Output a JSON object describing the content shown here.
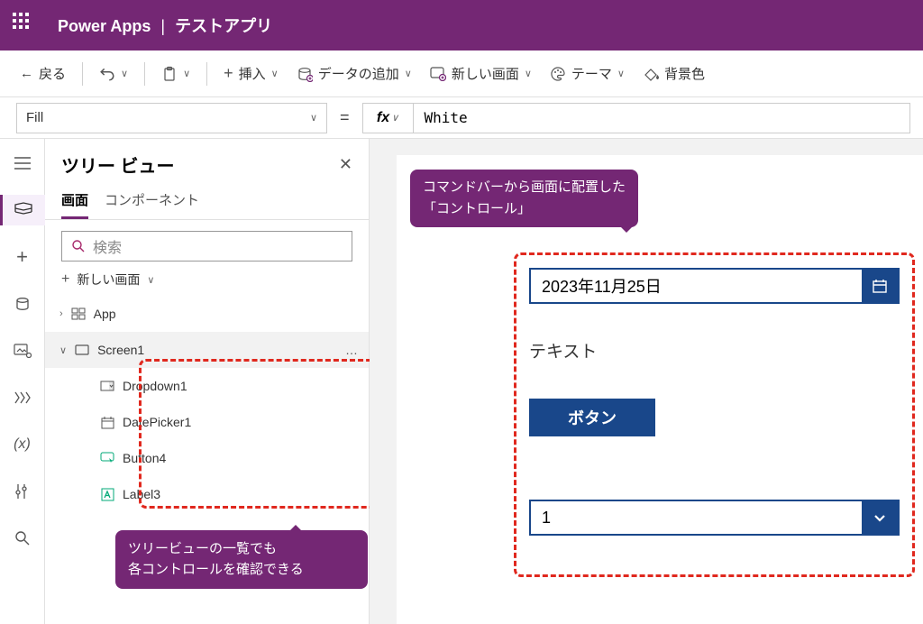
{
  "header": {
    "product": "Power Apps",
    "appname": "テストアプリ"
  },
  "cmd": {
    "back": "戻る",
    "insert": "挿入",
    "adddata": "データの追加",
    "newscreen": "新しい画面",
    "theme": "テーマ",
    "bgcolor": "背景色"
  },
  "fx": {
    "prop": "Fill",
    "value": "White"
  },
  "panel": {
    "title": "ツリー ビュー",
    "tabs": {
      "screens": "画面",
      "components": "コンポーネント"
    },
    "search_ph": "検索",
    "newscreen": "新しい画面",
    "app": "App",
    "screen1": "Screen1",
    "items": [
      {
        "name": "Dropdown1"
      },
      {
        "name": "DatePicker1"
      },
      {
        "name": "Button4"
      },
      {
        "name": "Label3"
      }
    ]
  },
  "canvas": {
    "date": "2023年11月25日",
    "label": "テキスト",
    "button": "ボタン",
    "dropdown": "1"
  },
  "annotations": {
    "tree": "ツリービューの一覧でも\n各コントロールを確認できる",
    "ctrl1": "コマンドバーから画面に配置した",
    "ctrl2": "「コントロール」"
  }
}
